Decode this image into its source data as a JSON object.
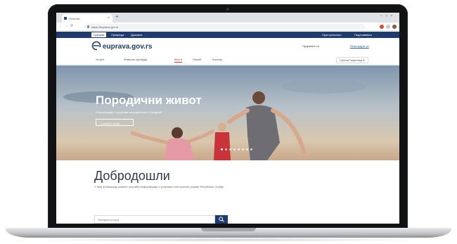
{
  "browser": {
    "tab_title": "Почетна",
    "url": "https://euprava.gov.rs"
  },
  "site": {
    "topstrip": {
      "left_links": [
        "Грађани",
        "Привреда",
        "Државни"
      ],
      "right_links": [
        "Приступачност",
        "Подешавања"
      ]
    },
    "logo_text": "euprava.gov.rs",
    "login_text": "Пријавите се",
    "login_link": "Региструјте се",
    "nav": [
      "Услуге",
      "Животни догађаји",
      "Вести",
      "Помоћ",
      "Контакт"
    ],
    "language": "Српски ћирилица"
  },
  "hero": {
    "title": "Породични живот",
    "subtitle": "Информације о услугама за родитеље и породице",
    "button": "Сазнајте више"
  },
  "welcome": {
    "title": "Добродошли",
    "subtitle": "У овој апликацији можете пронаћи информације о услугама електронске управе Републике Србије",
    "search_placeholder": "Претрага услуга"
  },
  "colors": {
    "brand": "#1f3c6e",
    "accent": "#c0392b"
  }
}
